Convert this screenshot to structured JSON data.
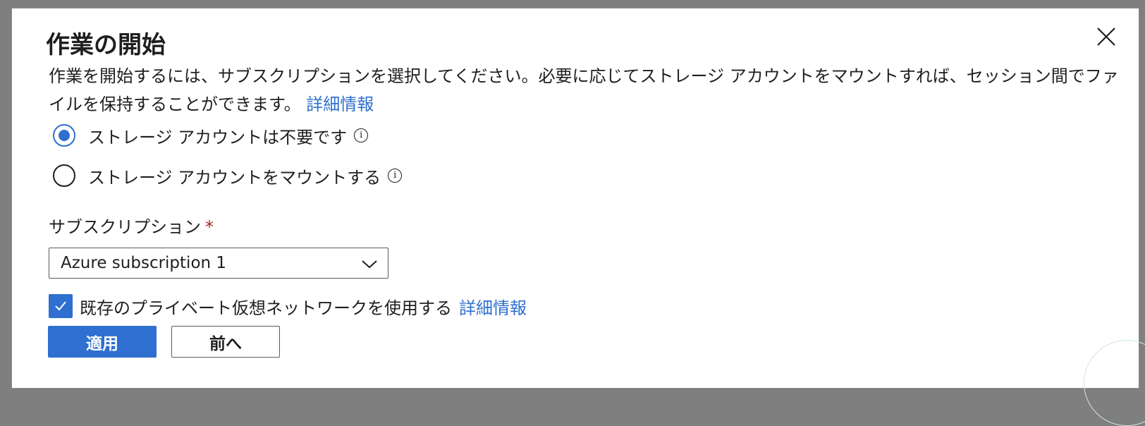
{
  "dialog": {
    "title": "作業の開始",
    "description": "作業を開始するには、サブスクリプションを選択してください。必要に応じてストレージ アカウントをマウントすれば、セッション間でファイルを保持することができます。",
    "learn_more": "詳細情報",
    "close_icon": "close-icon"
  },
  "storage_options": [
    {
      "label": "ストレージ アカウントは不要です",
      "selected": true,
      "info_icon": "info-icon"
    },
    {
      "label": "ストレージ アカウントをマウントする",
      "selected": false,
      "info_icon": "info-icon"
    }
  ],
  "subscription": {
    "label": "サブスクリプション",
    "required_marker": "*",
    "value": "Azure subscription 1",
    "dropdown_icon": "chevron-down-icon"
  },
  "private_network": {
    "label": "既存のプライベート仮想ネットワークを使用する",
    "checked": true,
    "learn_more": "詳細情報"
  },
  "buttons": {
    "apply": "適用",
    "previous": "前へ"
  },
  "colors": {
    "accent": "#2e6fcf",
    "required": "#a4262c",
    "overlay": "#7f7f7f"
  }
}
